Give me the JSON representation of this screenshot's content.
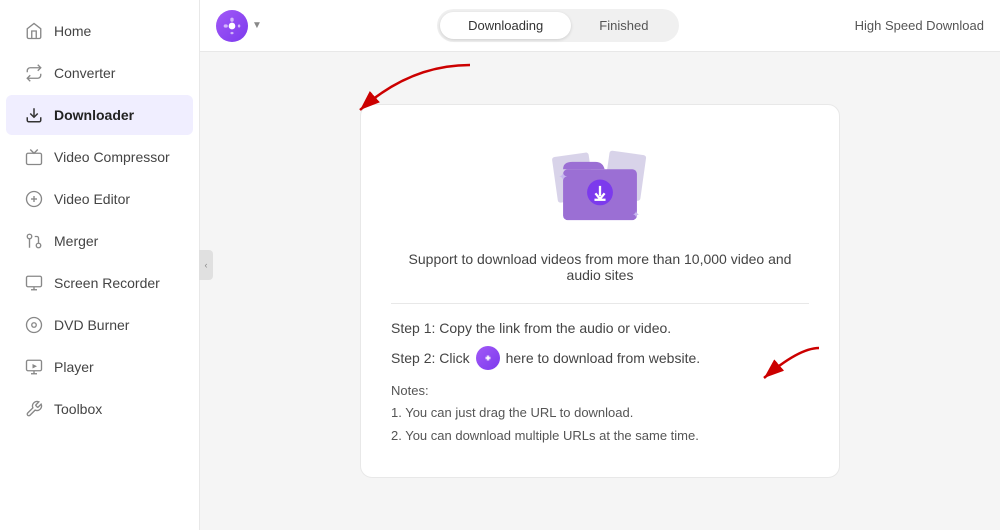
{
  "sidebar": {
    "items": [
      {
        "id": "home",
        "label": "Home",
        "active": false
      },
      {
        "id": "converter",
        "label": "Converter",
        "active": false
      },
      {
        "id": "downloader",
        "label": "Downloader",
        "active": true
      },
      {
        "id": "video-compressor",
        "label": "Video Compressor",
        "active": false
      },
      {
        "id": "video-editor",
        "label": "Video Editor",
        "active": false
      },
      {
        "id": "merger",
        "label": "Merger",
        "active": false
      },
      {
        "id": "screen-recorder",
        "label": "Screen Recorder",
        "active": false
      },
      {
        "id": "dvd-burner",
        "label": "DVD Burner",
        "active": false
      },
      {
        "id": "player",
        "label": "Player",
        "active": false
      },
      {
        "id": "toolbox",
        "label": "Toolbox",
        "active": false
      }
    ]
  },
  "topbar": {
    "tab_downloading": "Downloading",
    "tab_finished": "Finished",
    "high_speed": "High Speed Download"
  },
  "main": {
    "support_text": "Support to download videos from more than 10,000 video and audio sites",
    "step1": "Step 1: Copy the link from the audio or video.",
    "step2_prefix": "Step 2: Click",
    "step2_suffix": "here to download from website.",
    "notes_title": "Notes:",
    "note1": "1. You can just drag the URL to download.",
    "note2": "2. You can download multiple URLs at the same time."
  }
}
